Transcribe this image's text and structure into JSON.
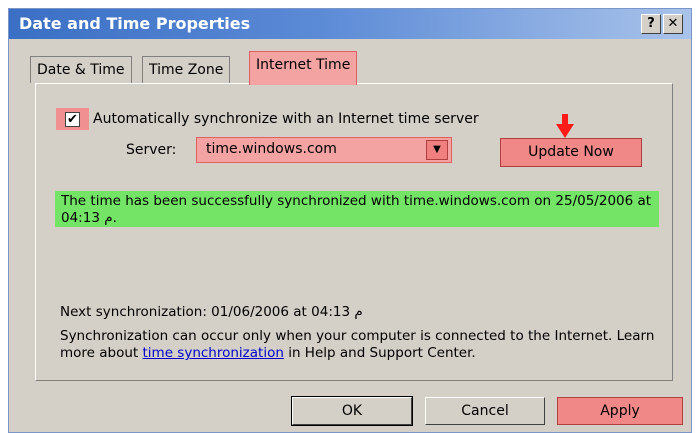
{
  "window": {
    "title": "Date and Time Properties",
    "help_label": "?",
    "close_label": "✕"
  },
  "tabs": [
    {
      "label": "Date & Time"
    },
    {
      "label": "Time Zone"
    },
    {
      "label": "Internet Time"
    }
  ],
  "sync": {
    "checked": true,
    "check_mark": "✔",
    "label": "Automatically synchronize with an Internet time server"
  },
  "server": {
    "label": "Server:",
    "value": "time.windows.com",
    "dropdown_icon": "▼"
  },
  "update_button": {
    "label": "Update Now"
  },
  "status": {
    "text": "The time has been successfully synchronized with time.windows.com on 25/05/2006 at 04:13 م."
  },
  "next_sync": {
    "text": "Next synchronization: 01/06/2006 at 04:13 م"
  },
  "info": {
    "before": "Synchronization can occur only when your computer is connected to the Internet.  Learn more about ",
    "link": "time synchronization",
    "after": " in Help and Support Center."
  },
  "buttons": {
    "ok": "OK",
    "cancel": "Cancel",
    "apply": "Apply"
  },
  "colors": {
    "highlight_red": "#f08888",
    "highlight_green": "#74e466",
    "arrow": "#ff1a1a",
    "titlebar": "#3a6fc4"
  }
}
